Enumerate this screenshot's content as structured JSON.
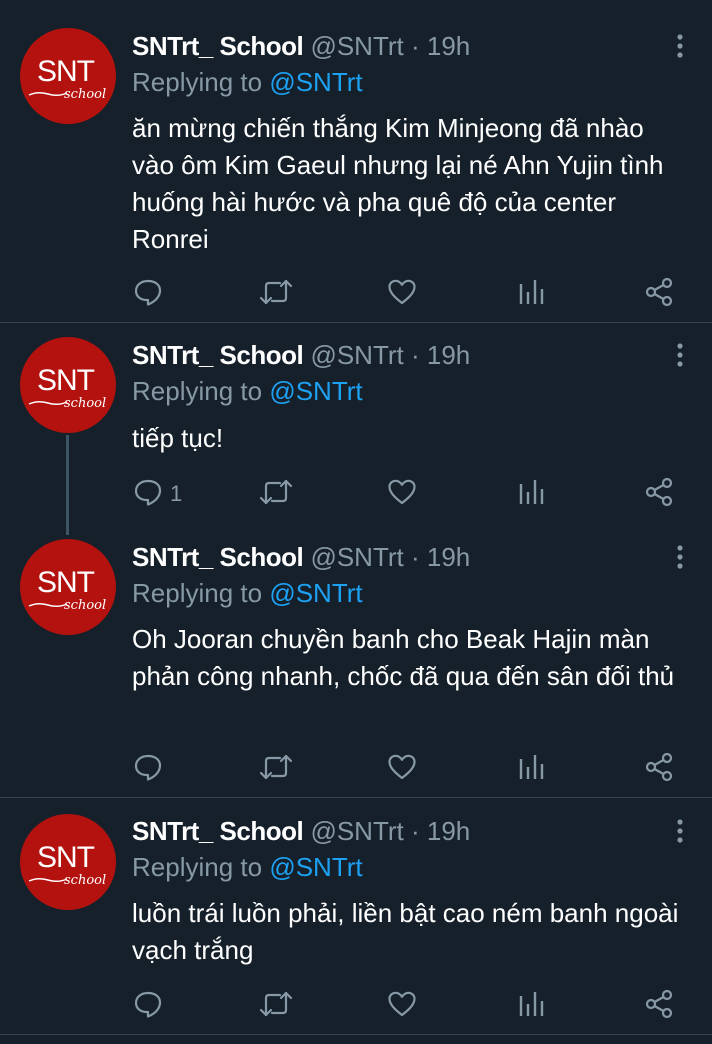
{
  "tweets": [
    {
      "name": "SNTrt_ School",
      "handle": "@SNTrt",
      "separator": "·",
      "time": "19h",
      "replying_prefix": "Replying to",
      "replying_to": "@SNTrt",
      "text": "ăn mừng chiến thắng Kim Minjeong đã nhào vào ôm Kim Gaeul nhưng lại né Ahn Yujin tình huống hài hước và pha quê độ của center Ronrei",
      "reply_count": ""
    },
    {
      "name": "SNTrt_ School",
      "handle": "@SNTrt",
      "separator": "·",
      "time": "19h",
      "replying_prefix": "Replying to",
      "replying_to": "@SNTrt",
      "text": "tiếp tục!",
      "reply_count": "1"
    },
    {
      "name": "SNTrt_ School",
      "handle": "@SNTrt",
      "separator": "·",
      "time": "19h",
      "replying_prefix": "Replying to",
      "replying_to": "@SNTrt",
      "text": "Oh Jooran chuyền banh cho Beak Hajin màn phản công nhanh, chốc đã qua đến sân đối thủ",
      "reply_count": ""
    },
    {
      "name": "SNTrt_ School",
      "handle": "@SNTrt",
      "separator": "·",
      "time": "19h",
      "replying_prefix": "Replying to",
      "replying_to": "@SNTrt",
      "text": "luồn trái luồn phải, liền bật cao ném banh ngoài vạch trắng",
      "reply_count": ""
    }
  ],
  "avatar": {
    "logo_main": "SNT",
    "logo_sub": "school"
  },
  "icons": {
    "more": "more-vertical-icon",
    "reply": "reply-bubble-icon",
    "retweet": "retweet-icon",
    "like": "heart-icon",
    "analytics": "analytics-bars-icon",
    "share": "share-icon"
  },
  "colors": {
    "background": "#15202b",
    "divider": "#38444d",
    "secondary_text": "#8899a6",
    "link": "#1da1f2",
    "avatar_red": "#b3120f",
    "thread_line": "#3d5466"
  }
}
